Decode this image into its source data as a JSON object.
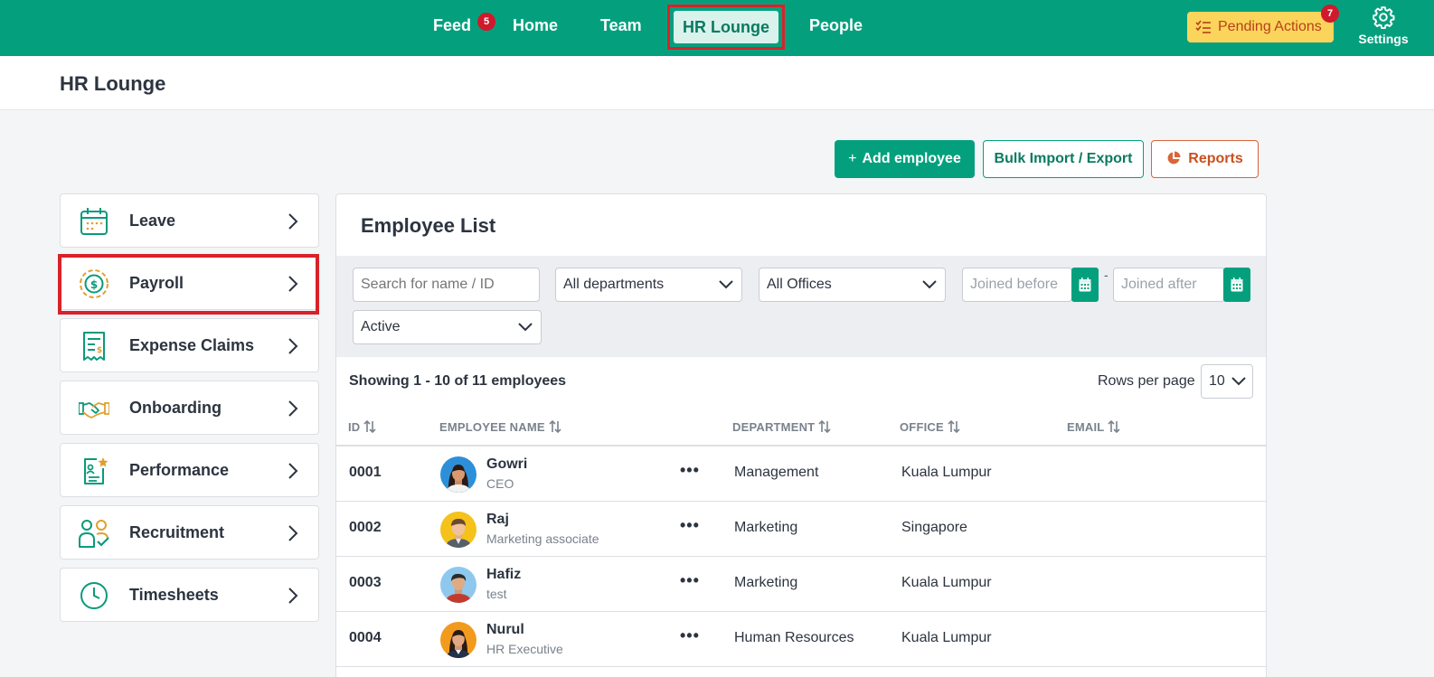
{
  "nav": {
    "items": [
      {
        "label": "Feed",
        "badge": "5"
      },
      {
        "label": "Home"
      },
      {
        "label": "Team"
      },
      {
        "label": "HR Lounge",
        "active": true
      },
      {
        "label": "People"
      }
    ],
    "pending_label": "Pending Actions",
    "pending_badge": "7",
    "settings_label": "Settings",
    "accent": "#04a07e"
  },
  "page": {
    "title": "HR Lounge"
  },
  "actions": {
    "add_label": "Add employee",
    "bulk_label": "Bulk Import / Export",
    "reports_label": "Reports"
  },
  "sidebar": {
    "items": [
      {
        "label": "Leave",
        "icon": "calendar-icon"
      },
      {
        "label": "Payroll",
        "icon": "dollar-coin-icon",
        "highlighted": true
      },
      {
        "label": "Expense Claims",
        "icon": "receipt-icon"
      },
      {
        "label": "Onboarding",
        "icon": "handshake-icon"
      },
      {
        "label": "Performance",
        "icon": "performance-doc-icon"
      },
      {
        "label": "Recruitment",
        "icon": "recruit-users-icon"
      },
      {
        "label": "Timesheets",
        "icon": "clock-icon"
      }
    ]
  },
  "employee_list": {
    "title": "Employee List",
    "filters": {
      "search_placeholder": "Search for name / ID",
      "department": "All departments",
      "office": "All Offices",
      "joined_before_placeholder": "Joined before",
      "separator": "-",
      "joined_after_placeholder": "Joined after",
      "status": "Active"
    },
    "showing": "Showing 1 - 10 of 11 employees",
    "rows_per_page_label": "Rows per page",
    "rows_per_page": "10",
    "columns": [
      "ID",
      "EMPLOYEE NAME",
      "DEPARTMENT",
      "OFFICE",
      "EMAIL"
    ],
    "rows": [
      {
        "id": "0001",
        "name": "Gowri",
        "role": "CEO",
        "department": "Management",
        "office": "Kuala Lumpur"
      },
      {
        "id": "0002",
        "name": "Raj",
        "role": "Marketing associate",
        "department": "Marketing",
        "office": "Singapore"
      },
      {
        "id": "0003",
        "name": "Hafiz",
        "role": "test",
        "department": "Marketing",
        "office": "Kuala Lumpur"
      },
      {
        "id": "0004",
        "name": "Nurul",
        "role": "HR Executive",
        "department": "Human Resources",
        "office": "Kuala Lumpur"
      }
    ]
  }
}
